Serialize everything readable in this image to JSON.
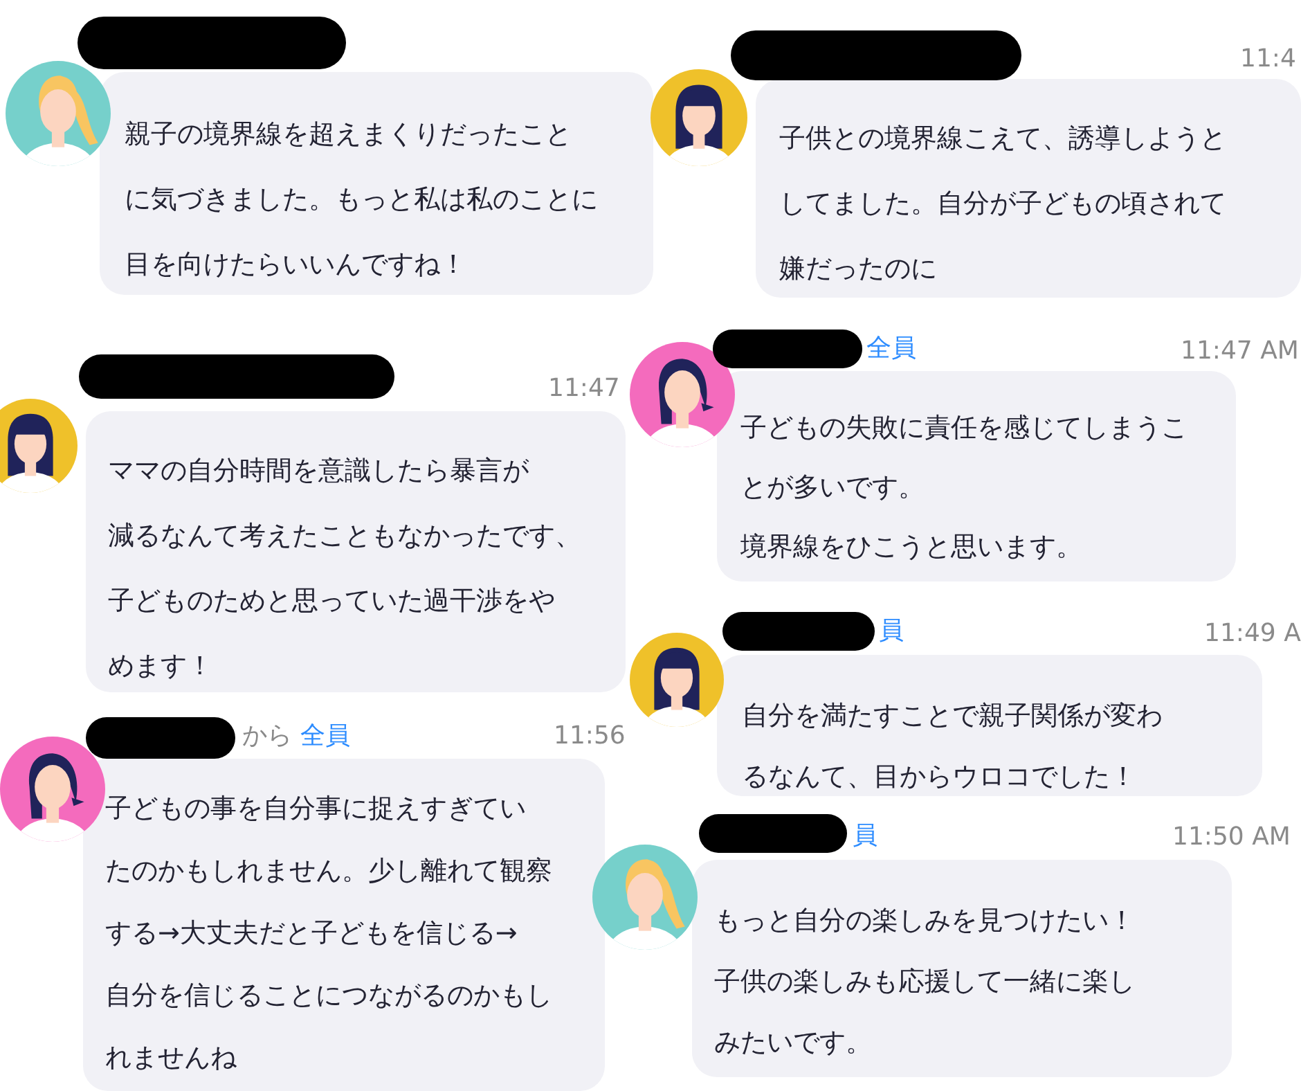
{
  "messages": [
    {
      "avatar": {
        "color": "#76d0cb",
        "kind": "ponytail"
      },
      "lines": [
        "親子の境界線を超えまくりだったこと",
        "に気づきました。もっと私は私のことに",
        "目を向けたらいいんですね！"
      ]
    },
    {
      "time": "11:4",
      "avatar": {
        "color": "#efc12a",
        "kind": "bangs"
      },
      "lines": [
        "子供との境界線こえて、誘導しようと",
        "してました。自分が子どもの頃されて",
        "嫌だったのに"
      ]
    },
    {
      "time": "11:47",
      "avatar": {
        "color": "#efc12a",
        "kind": "bangs"
      },
      "lines": [
        "ママの自分時間を意識したら暴言が",
        "減るなんて考えたこともなかったです、",
        "子どものためと思っていた過干渉をや",
        "めます！"
      ]
    },
    {
      "recipient": "全員",
      "time": "11:47 AM",
      "avatar": {
        "color": "#f46bbd",
        "kind": "side"
      },
      "lines": [
        "子どもの失敗に責任を感じてしまうこ",
        "とが多いです。",
        "境界線をひこうと思います。"
      ]
    },
    {
      "recipient": "員",
      "time": "11:49 A",
      "avatar": {
        "color": "#efc12a",
        "kind": "bangs"
      },
      "lines": [
        "自分を満たすことで親子関係が変わ",
        "るなんて、目からウロコでした！"
      ]
    },
    {
      "from_label": "から",
      "recipient": "全員",
      "time": "11:56",
      "avatar": {
        "color": "#f46bbd",
        "kind": "side"
      },
      "lines": [
        "子どもの事を自分事に捉えすぎてい",
        "たのかもしれません。少し離れて観察",
        "する→大丈夫だと子どもを信じる→",
        "自分を信じることにつながるのかもし",
        "れませんね"
      ]
    },
    {
      "recipient": "員",
      "time": "11:50 AM",
      "avatar": {
        "color": "#76d0cb",
        "kind": "ponytail"
      },
      "lines": [
        "もっと自分の楽しみを見つけたい！",
        "子供の楽しみも応援して一緒に楽し",
        "みたいです。"
      ]
    }
  ]
}
